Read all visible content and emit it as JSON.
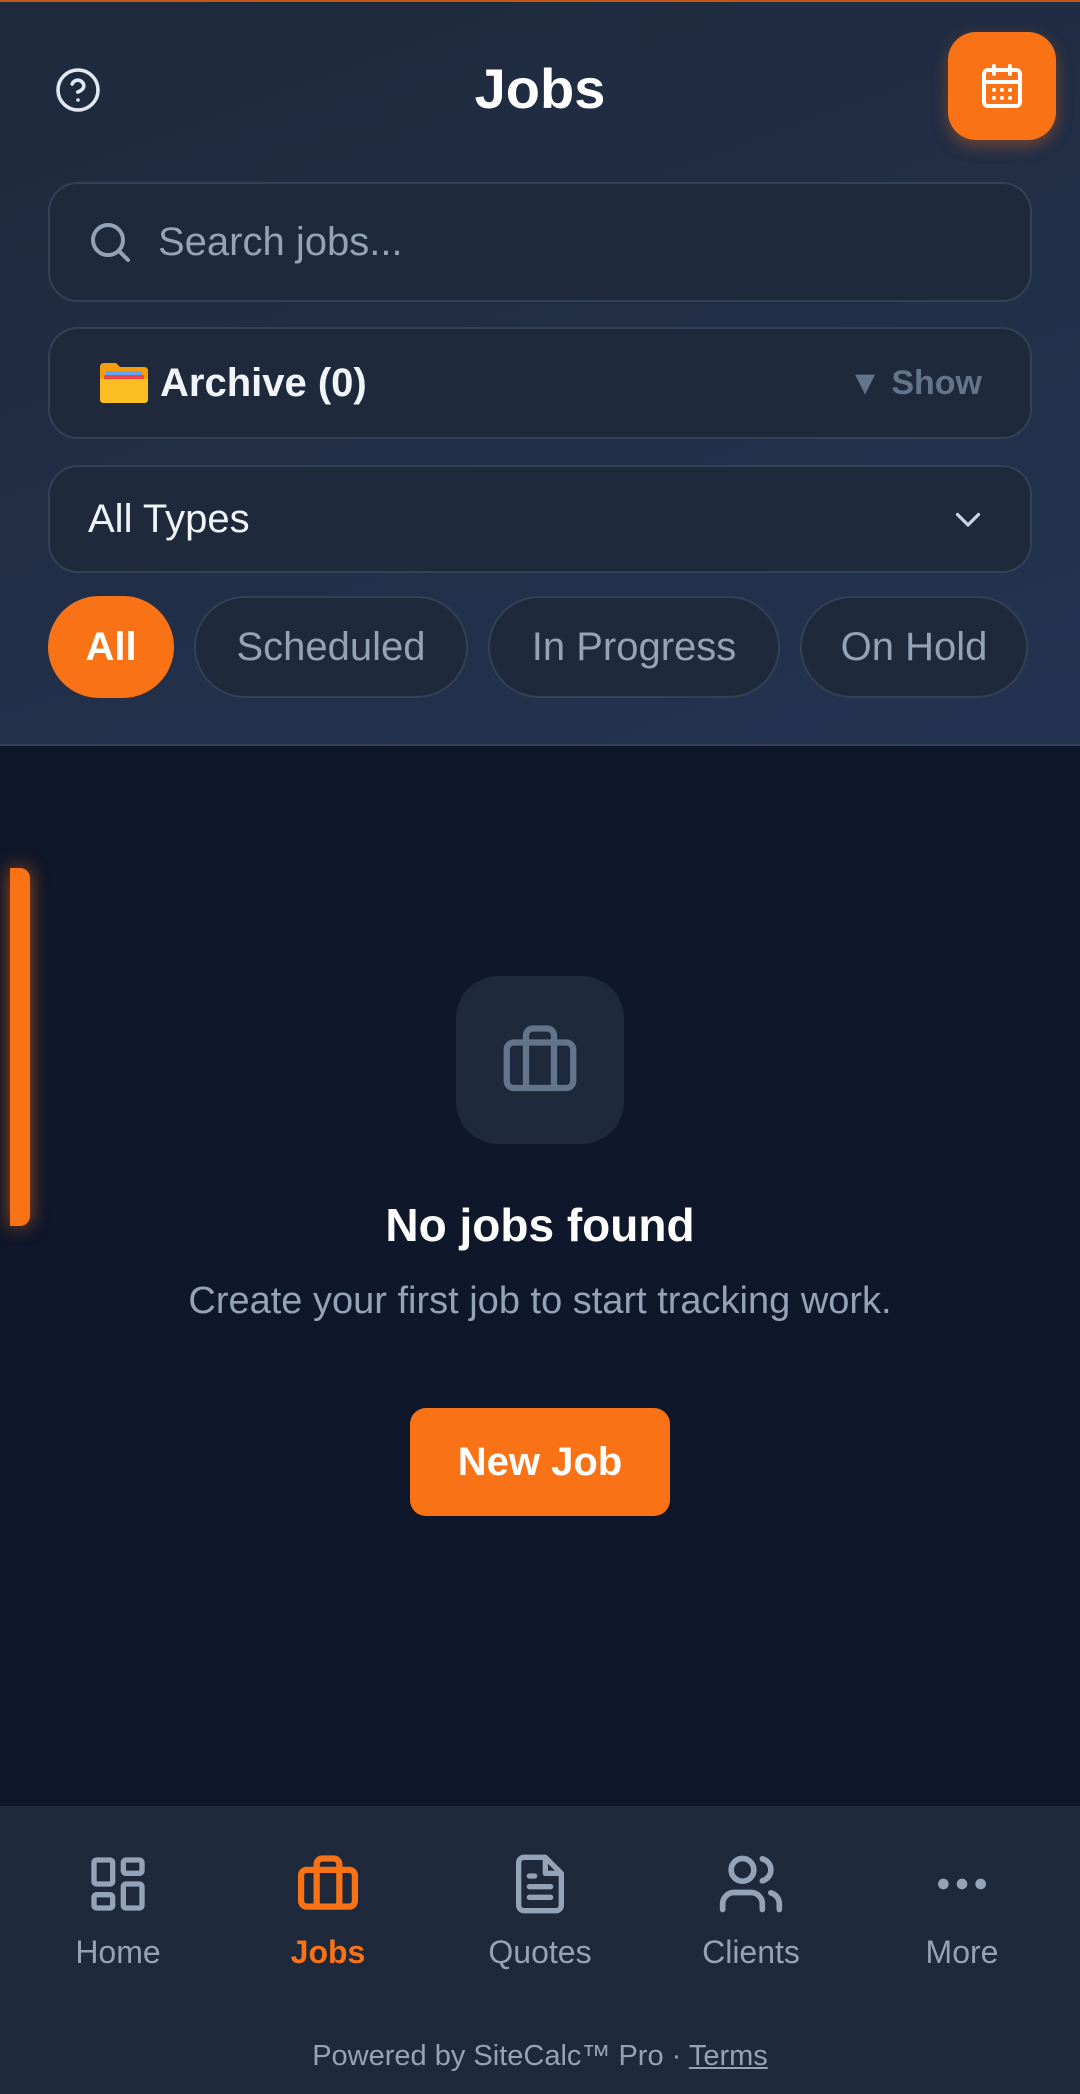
{
  "header": {
    "title": "Jobs",
    "help_icon": "help-circle-icon",
    "calendar_icon": "calendar-icon"
  },
  "search": {
    "placeholder": "Search jobs...",
    "value": ""
  },
  "archive": {
    "icon": "folder-icon",
    "label": "Archive (0)",
    "toggle_label": "▼ Show"
  },
  "type_filter": {
    "selected": "All Types"
  },
  "status_filters": [
    {
      "label": "All",
      "active": true
    },
    {
      "label": "Scheduled",
      "active": false
    },
    {
      "label": "In Progress",
      "active": false
    },
    {
      "label": "On Hold",
      "active": false
    }
  ],
  "empty_state": {
    "icon": "briefcase-icon",
    "title": "No jobs found",
    "message": "Create your first job to start tracking work.",
    "button_label": "New Job"
  },
  "bottom_nav": [
    {
      "label": "Home",
      "icon": "dashboard-icon",
      "active": false
    },
    {
      "label": "Jobs",
      "icon": "briefcase-icon",
      "active": true
    },
    {
      "label": "Quotes",
      "icon": "document-icon",
      "active": false
    },
    {
      "label": "Clients",
      "icon": "users-icon",
      "active": false
    },
    {
      "label": "More",
      "icon": "more-dots-icon",
      "active": false
    }
  ],
  "footer": {
    "powered_by": "Powered by SiteCalc™ Pro · ",
    "terms_label": "Terms"
  },
  "colors": {
    "accent": "#f97316",
    "background": "#0f172a",
    "surface": "#1e293b",
    "muted_text": "#94a3b8"
  }
}
